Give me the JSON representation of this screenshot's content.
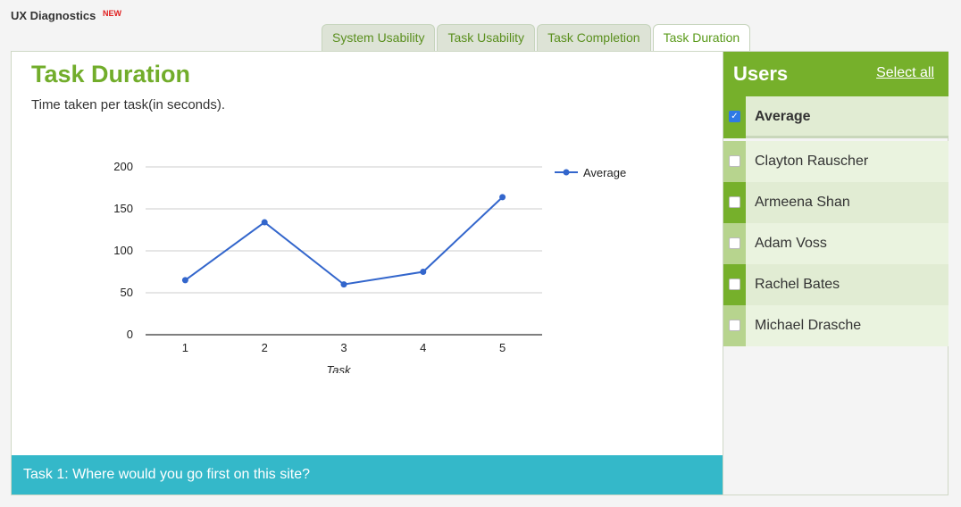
{
  "app": {
    "title": "UX Diagnostics",
    "badge": "NEW"
  },
  "tabs": [
    {
      "label": "System Usability",
      "active": false
    },
    {
      "label": "Task Usability",
      "active": false
    },
    {
      "label": "Task Completion",
      "active": false
    },
    {
      "label": "Task Duration",
      "active": true
    }
  ],
  "main": {
    "title": "Task Duration",
    "subtitle": "Time taken per task(in seconds).",
    "task_bar": "Task 1: Where would you go first on this site?"
  },
  "sidebar": {
    "title": "Users",
    "select_all": "Select all",
    "users": [
      {
        "name": "Average",
        "checked": true
      },
      {
        "name": "Clayton Rauscher",
        "checked": false
      },
      {
        "name": "Armeena Shan",
        "checked": false
      },
      {
        "name": "Adam Voss",
        "checked": false
      },
      {
        "name": "Rachel Bates",
        "checked": false
      },
      {
        "name": "Michael Drasche",
        "checked": false
      }
    ]
  },
  "colors": {
    "accent": "#76b02b",
    "line": "#3366cc",
    "task_bar": "#34b8c9"
  },
  "chart_data": {
    "type": "line",
    "x": [
      1,
      2,
      3,
      4,
      5
    ],
    "series": [
      {
        "name": "Average",
        "values": [
          65,
          134,
          60,
          75,
          164
        ]
      }
    ],
    "xlabel": "Task",
    "ylabel": "",
    "yticks": [
      0,
      50,
      100,
      150,
      200
    ],
    "ylim": [
      0,
      200
    ],
    "grid": true,
    "legend": "top-right"
  }
}
